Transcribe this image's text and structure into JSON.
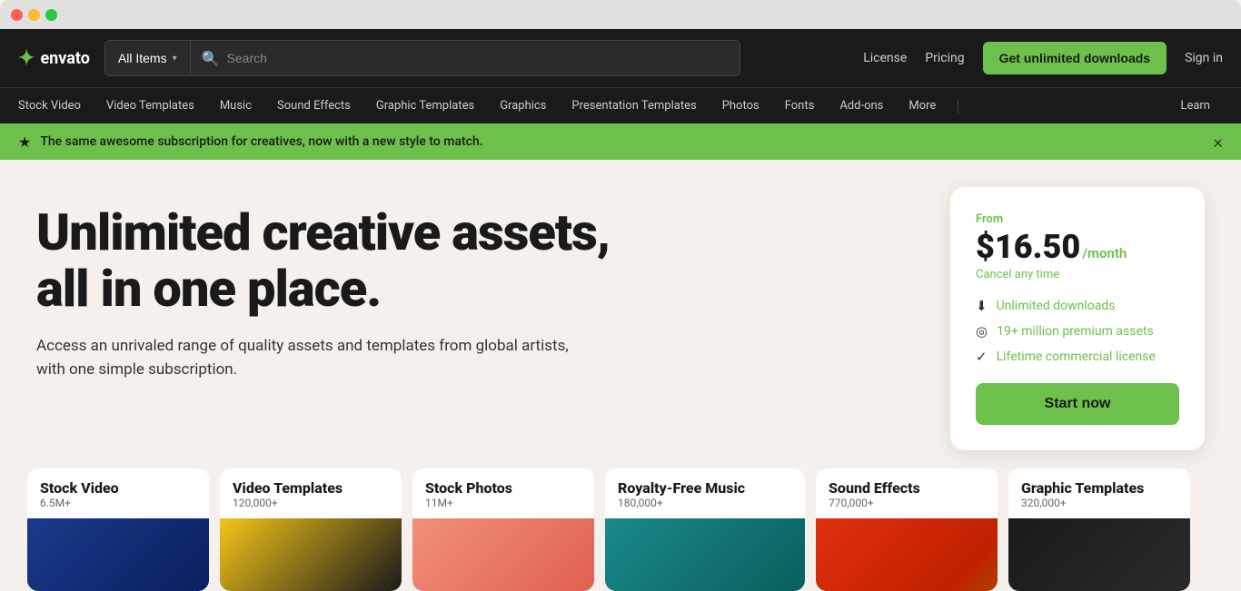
{
  "window": {
    "dots": [
      "red",
      "yellow",
      "green"
    ]
  },
  "navbar": {
    "logo_text": "envato",
    "all_items_label": "All Items",
    "search_placeholder": "Search",
    "nav_links": [
      {
        "label": "License",
        "id": "license"
      },
      {
        "label": "Pricing",
        "id": "pricing"
      }
    ],
    "cta_button": "Get unlimited downloads",
    "sign_in": "Sign in"
  },
  "secondary_nav": {
    "items": [
      {
        "label": "Stock Video"
      },
      {
        "label": "Video Templates"
      },
      {
        "label": "Music"
      },
      {
        "label": "Sound Effects"
      },
      {
        "label": "Graphic Templates"
      },
      {
        "label": "Graphics"
      },
      {
        "label": "Presentation Templates"
      },
      {
        "label": "Photos"
      },
      {
        "label": "Fonts"
      },
      {
        "label": "Add-ons"
      },
      {
        "label": "More"
      }
    ],
    "learn_label": "Learn"
  },
  "banner": {
    "text": "The same awesome subscription for creatives, now with a new style to match.",
    "close_label": "×"
  },
  "hero": {
    "title_line1": "Unlimited creative assets,",
    "title_line2": "all in one place.",
    "subtitle": "Access an unrivaled range of quality assets and templates from global artists,",
    "subtitle2": "with one simple subscription."
  },
  "pricing_card": {
    "from_label": "From",
    "price": "$16.50",
    "period": "/month",
    "cancel_text": "Cancel any time",
    "features": [
      {
        "icon": "↓",
        "text": "Unlimited downloads"
      },
      {
        "icon": "◎",
        "text": "19+ million premium assets"
      },
      {
        "icon": "✓",
        "text": "Lifetime commercial license"
      }
    ],
    "cta_button": "Start now"
  },
  "cards": [
    {
      "title": "Stock Video",
      "count": "6.5M+",
      "img_class": "img-blue"
    },
    {
      "title": "Video Templates",
      "count": "120,000+",
      "img_class": "img-yellow-black"
    },
    {
      "title": "Stock Photos",
      "count": "11M+",
      "img_class": "img-salmon"
    },
    {
      "title": "Royalty-Free Music",
      "count": "180,000+",
      "img_class": "img-teal"
    },
    {
      "title": "Sound Effects",
      "count": "770,000+",
      "img_class": "img-red-orange"
    },
    {
      "title": "Graphic Templates",
      "count": "320,000+",
      "img_class": "img-dark"
    }
  ],
  "colors": {
    "accent": "#6dc04b",
    "dark_bg": "#1a1a1a",
    "hero_bg": "#f5f0eb"
  }
}
